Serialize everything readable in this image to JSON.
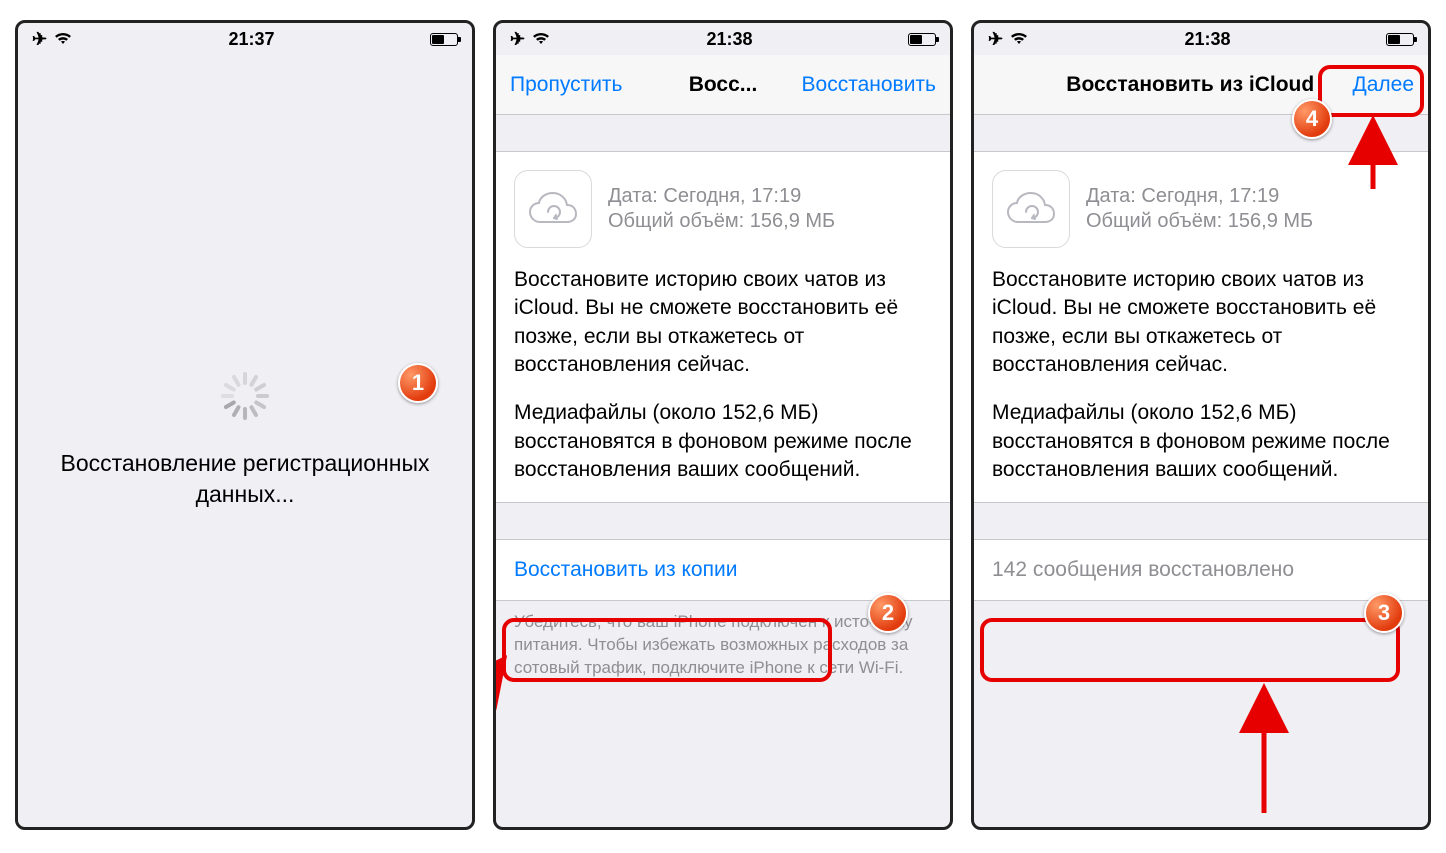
{
  "screen1": {
    "time": "21:37",
    "loading_text": "Восстановление регистрационных данных..."
  },
  "screen2": {
    "time": "21:38",
    "nav_left": "Пропустить",
    "nav_title": "Восс...",
    "nav_right": "Восстановить",
    "backup_date_label": "Дата: Сегодня, 17:19",
    "backup_size_label": "Общий объём: 156,9 МБ",
    "para1": "Восстановите историю своих чатов из iCloud. Вы не сможете восстановить её позже, если вы откажетесь от восстановления сейчас.",
    "para2": "Медиафайлы (около 152,6 МБ) восстановятся в фоновом режиме после восстановления ваших сообщений.",
    "action": "Восстановить из копии",
    "footer": "Убедитесь, что ваш iPhone подключен к источнику питания. Чтобы избежать возможных расходов за сотовый трафик, подключите iPhone к сети Wi-Fi."
  },
  "screen3": {
    "time": "21:38",
    "nav_title": "Восстановить из iCloud",
    "nav_right": "Далее",
    "backup_date_label": "Дата: Сегодня, 17:19",
    "backup_size_label": "Общий объём: 156,9 МБ",
    "para1": "Восстановите историю своих чатов из iCloud. Вы не сможете восстановить её позже, если вы откажетесь от восстановления сейчас.",
    "para2": "Медиафайлы (около 152,6 МБ) восстановятся в фоновом режиме после восстановления ваших сообщений.",
    "status": "142 сообщения восстановлено"
  },
  "callouts": {
    "1": "1",
    "2": "2",
    "3": "3",
    "4": "4"
  }
}
